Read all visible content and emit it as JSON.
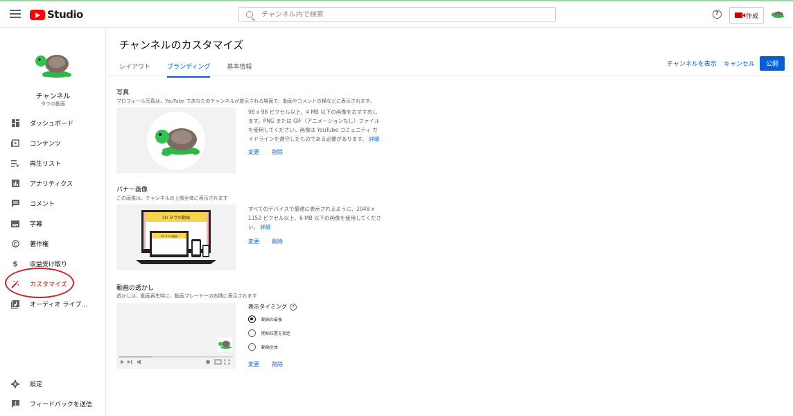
{
  "topbar": {
    "logo_text": "Studio",
    "search_placeholder": "チャンネル内で検索",
    "help": "?",
    "create_label": "作成"
  },
  "sidebar": {
    "channel_label": "チャンネル",
    "channel_name": "タラの動画",
    "items": [
      {
        "label": "ダッシュボード",
        "icon": "dashboard-icon"
      },
      {
        "label": "コンテンツ",
        "icon": "content-icon"
      },
      {
        "label": "再生リスト",
        "icon": "playlist-icon"
      },
      {
        "label": "アナリティクス",
        "icon": "analytics-icon"
      },
      {
        "label": "コメント",
        "icon": "comment-icon"
      },
      {
        "label": "字幕",
        "icon": "subtitles-icon"
      },
      {
        "label": "著作権",
        "icon": "copyright-icon"
      },
      {
        "label": "収益受け取り",
        "icon": "dollar-icon"
      },
      {
        "label": "カスタマイズ",
        "icon": "magic-wand-icon"
      },
      {
        "label": "オーディオ ライブ...",
        "icon": "audio-library-icon"
      }
    ],
    "bottom_items": [
      {
        "label": "設定",
        "icon": "gear-icon"
      },
      {
        "label": "フィードバックを送信",
        "icon": "feedback-icon"
      }
    ]
  },
  "main": {
    "title": "チャンネルのカスタマイズ",
    "tabs": [
      "レイアウト",
      "ブランディング",
      "基本情報"
    ],
    "active_tab": "ブランディング",
    "view_channel": "チャンネルを表示",
    "cancel": "キャンセル",
    "publish": "公開",
    "photo": {
      "title": "写真",
      "desc": "プロフィール写真は、YouTube であなたのチャンネルが提示される場面で、動画やコメントの横などに表示されます。",
      "info": "98 x 98 ピクセル以上、4 MB 以下の画像をおすすめします。PNG または GIF（アニメーションなし）ファイルを使用してください。画像は YouTube コミュニティ ガイドラインを遵守したものである必要があります。",
      "detail_link": "詳細",
      "change": "変更",
      "delete": "削除"
    },
    "banner": {
      "title": "バナー画像",
      "desc": "この画像は、チャンネルの上部全体に表示されます",
      "info": "すべてのデバイスで最適に表示されるように、2048 x 1152 ピクセル以上、6 MB 以下の画像を使用してください。",
      "detail_link": "詳細",
      "change": "変更",
      "delete": "削除",
      "banner_text": "3D タラの動画",
      "banner_text_small": "3D タラの動画"
    },
    "watermark": {
      "title": "動画の透かし",
      "desc": "透かしは、動画再生時に、動画プレーヤーの右隅に表示されます",
      "timing_label": "表示タイミング",
      "options": [
        "動画の最後",
        "開始位置を指定",
        "動画全体"
      ],
      "selected_option": "動画の最後",
      "change": "変更",
      "delete": "削除"
    }
  },
  "colors": {
    "accent_blue": "#065fd4",
    "active_red": "#cc0000",
    "banner_yellow": "#f7d44c",
    "turtle_green": "#2fb84a"
  }
}
